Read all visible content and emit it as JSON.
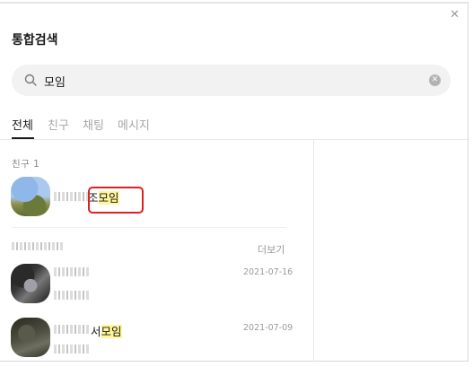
{
  "window": {
    "title": "통합검색",
    "close_icon": "close-icon"
  },
  "search": {
    "query": "모임",
    "icon": "search-icon",
    "clear_icon": "clear-icon"
  },
  "tabs": [
    {
      "label": "전체",
      "active": true
    },
    {
      "label": "친구",
      "active": false
    },
    {
      "label": "채팅",
      "active": false
    },
    {
      "label": "메시지",
      "active": false
    }
  ],
  "friends_section": {
    "header": "친구 1",
    "items": [
      {
        "name_prefix": "조",
        "name_highlight": "모임"
      }
    ]
  },
  "chats_section": {
    "more_label": "더보기",
    "items": [
      {
        "name_prefix": "",
        "name_highlight": "",
        "date": "2021-07-16"
      },
      {
        "name_prefix": "서",
        "name_highlight": "모임",
        "date": "2021-07-09"
      }
    ]
  },
  "colors": {
    "highlight": "#fff59a",
    "annotation_box": "#e02020"
  }
}
